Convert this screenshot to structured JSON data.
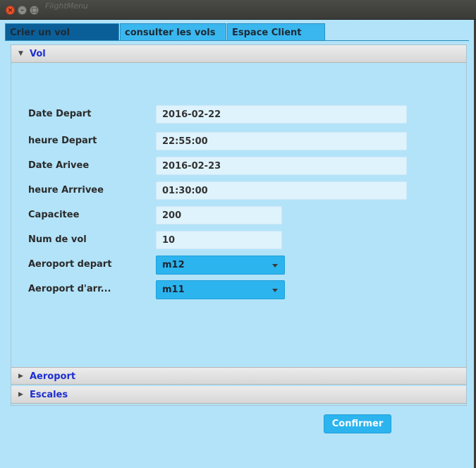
{
  "window": {
    "title": "FlightMenu"
  },
  "tabs": [
    {
      "label": "Crier un vol",
      "active": true
    },
    {
      "label": "consulter les vols",
      "active": false
    },
    {
      "label": "Espace Client",
      "active": false
    }
  ],
  "accordion": {
    "vol": {
      "title": "Vol",
      "expanded": true,
      "form": {
        "date_depart_label": "Date Depart",
        "date_depart_value": "2016-02-22",
        "heure_depart_label": "heure Depart",
        "heure_depart_value": "22:55:00",
        "date_arrivee_label": "Date Arivee",
        "date_arrivee_value": "2016-02-23",
        "heure_arrivee_label": "heure Arrrivee",
        "heure_arrivee_value": "01:30:00",
        "capacite_label": "Capacitee",
        "capacite_value": "200",
        "num_vol_label": "Num de vol",
        "num_vol_value": "10",
        "aeroport_depart_label": "Aeroport depart",
        "aeroport_depart_value": "m12",
        "aeroport_arrivee_label": "Aeroport d'arr...",
        "aeroport_arrivee_value": "m11"
      }
    },
    "aeroport": {
      "title": "Aeroport",
      "expanded": false
    },
    "escales": {
      "title": "Escales",
      "expanded": false
    }
  },
  "actions": {
    "confirm_label": "Confirmer"
  },
  "colors": {
    "background": "#b3e3f8",
    "active_tab": "#0b5f98",
    "inactive_tab": "#3bb7ef",
    "accent_button": "#2cb4ef",
    "pane_title": "#1f2fd0"
  },
  "icons": {
    "expanded": "triangle-down",
    "collapsed": "triangle-right",
    "dropdown": "caret-down"
  }
}
